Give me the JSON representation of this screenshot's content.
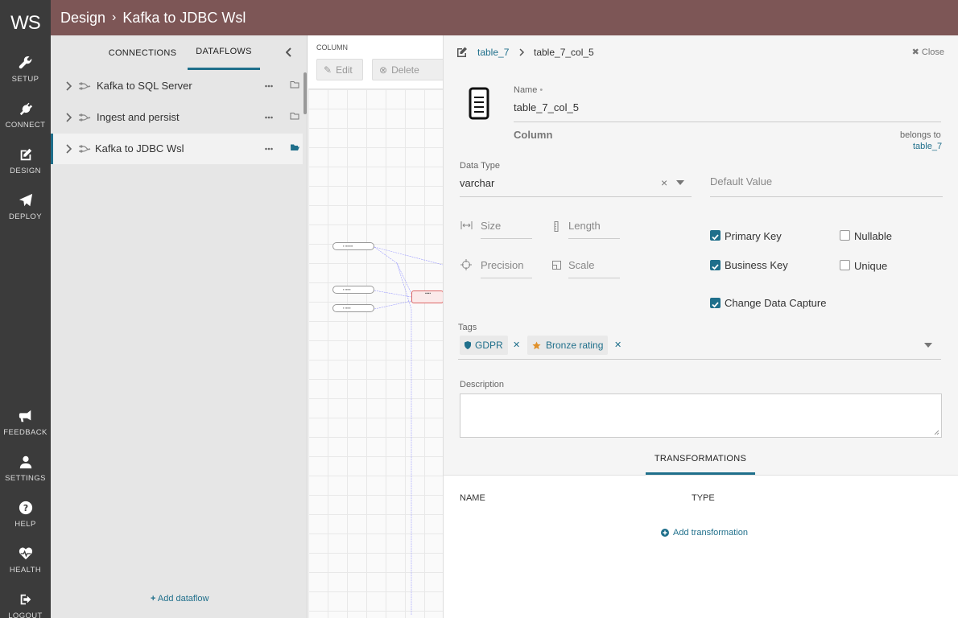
{
  "app": {
    "logo": "WS"
  },
  "nav": {
    "items": [
      {
        "label": "SETUP"
      },
      {
        "label": "CONNECT"
      },
      {
        "label": "DESIGN"
      },
      {
        "label": "DEPLOY"
      },
      {
        "label": "FEEDBACK"
      },
      {
        "label": "SETTINGS"
      },
      {
        "label": "HELP"
      },
      {
        "label": "HEALTH"
      },
      {
        "label": "LOGOUT"
      }
    ]
  },
  "header": {
    "section": "Design",
    "title": "Kafka to JDBC Wsl"
  },
  "list_panel": {
    "tabs": [
      {
        "label": "CONNECTIONS",
        "active": false
      },
      {
        "label": "DATAFLOWS",
        "active": true
      }
    ],
    "dataflows": [
      {
        "name": "Kafka to SQL Server",
        "selected": false
      },
      {
        "name": "Ingest and persist",
        "selected": false
      },
      {
        "name": "Kafka to JDBC Wsl",
        "selected": true
      }
    ],
    "add_label": "Add dataflow"
  },
  "canvas": {
    "section_label": "COLUMN",
    "edit_label": "Edit",
    "delete_label": "Delete"
  },
  "detail": {
    "breadcrumb": {
      "parent": "table_7",
      "current": "table_7_col_5"
    },
    "close_label": "Close",
    "name_label": "Name",
    "name_value": "table_7_col_5",
    "type_label": "Column",
    "belongs_to_label": "belongs to",
    "belongs_to_value": "table_7",
    "data_type_label": "Data Type",
    "data_type_value": "varchar",
    "default_value_placeholder": "Default Value",
    "size_placeholder": "Size",
    "length_placeholder": "Length",
    "precision_placeholder": "Precision",
    "scale_placeholder": "Scale",
    "checkboxes": {
      "primary_key": {
        "label": "Primary Key",
        "checked": true
      },
      "nullable": {
        "label": "Nullable",
        "checked": false
      },
      "business_key": {
        "label": "Business Key",
        "checked": true
      },
      "unique": {
        "label": "Unique",
        "checked": false
      },
      "change_data_capture": {
        "label": "Change Data Capture",
        "checked": true
      }
    },
    "tags_label": "Tags",
    "tags": [
      {
        "label": "GDPR",
        "icon": "shield-icon"
      },
      {
        "label": "Bronze rating",
        "icon": "star-icon"
      }
    ],
    "description_label": "Description",
    "description_value": "",
    "transformations": {
      "tab_label": "TRANSFORMATIONS",
      "columns": [
        "NAME",
        "TYPE"
      ],
      "add_label": "Add transformation"
    }
  },
  "colors": {
    "header_bg": "#7d5656",
    "nav_bg": "#3b3b3b",
    "accent": "#1f6f8b",
    "star": "#e0902a"
  }
}
